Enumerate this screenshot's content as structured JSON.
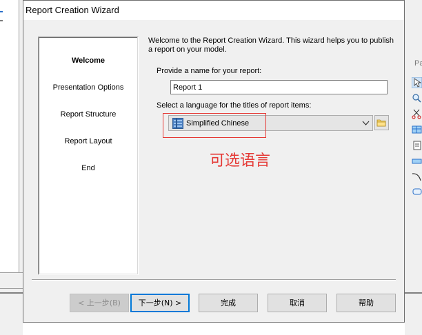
{
  "dialog": {
    "title": "Report Creation Wizard"
  },
  "steps": [
    {
      "label": "Welcome",
      "active": true
    },
    {
      "label": "Presentation Options",
      "active": false
    },
    {
      "label": "Report Structure",
      "active": false
    },
    {
      "label": "Report Layout",
      "active": false
    },
    {
      "label": "End",
      "active": false
    }
  ],
  "main": {
    "intro_text": "Welcome to the Report Creation Wizard. This wizard helps you to publish a report on your model.",
    "name_label": "Provide a name for your report:",
    "name_value": "Report 1",
    "language_label": "Select a language for the titles of report items:",
    "language_value": "Simplified Chinese",
    "annotation": "可选语言"
  },
  "buttons": {
    "back": "< 上一步(B)",
    "next": "下一步(N) >",
    "finish": "完成",
    "cancel": "取消",
    "help": "帮助"
  },
  "background": {
    "palette_label": "Pa"
  },
  "colors": {
    "annotation": "#e53935",
    "focus": "#0078d7"
  }
}
